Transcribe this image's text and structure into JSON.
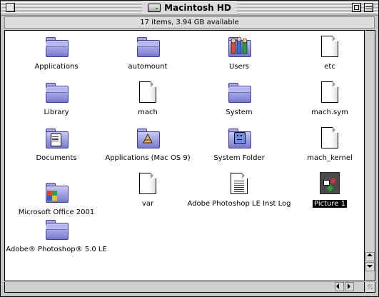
{
  "window": {
    "title": "Macintosh HD",
    "info": "17 items, 3.94 GB available"
  },
  "items": [
    {
      "label": "Applications",
      "icon": "folder-icon"
    },
    {
      "label": "automount",
      "icon": "folder-icon"
    },
    {
      "label": "Users",
      "icon": "users-folder-icon"
    },
    {
      "label": "etc",
      "icon": "document-icon"
    },
    {
      "label": "Library",
      "icon": "folder-icon"
    },
    {
      "label": "mach",
      "icon": "document-icon"
    },
    {
      "label": "System",
      "icon": "folder-icon"
    },
    {
      "label": "mach.sym",
      "icon": "document-icon"
    },
    {
      "label": "Documents",
      "icon": "documents-folder-icon"
    },
    {
      "label": "Applications (Mac OS 9)",
      "icon": "applications-folder-icon"
    },
    {
      "label": "System Folder",
      "icon": "system-folder-icon"
    },
    {
      "label": "mach_kernel",
      "icon": "document-icon"
    },
    {
      "label": "Microsoft Office 2001",
      "icon": "office-folder-icon"
    },
    {
      "label": "var",
      "icon": "document-icon"
    },
    {
      "label": "Adobe Photoshop LE Inst Log",
      "icon": "text-document-icon"
    },
    {
      "label": "Picture 1",
      "icon": "picture-document-icon",
      "selected": true
    },
    {
      "label": "Adobe® Photoshop® 5.0 LE",
      "icon": "folder-icon"
    }
  ],
  "colors": {
    "folder": "#8c8ce0",
    "selection": "#000000",
    "window_frame": "#c7c7c7"
  }
}
